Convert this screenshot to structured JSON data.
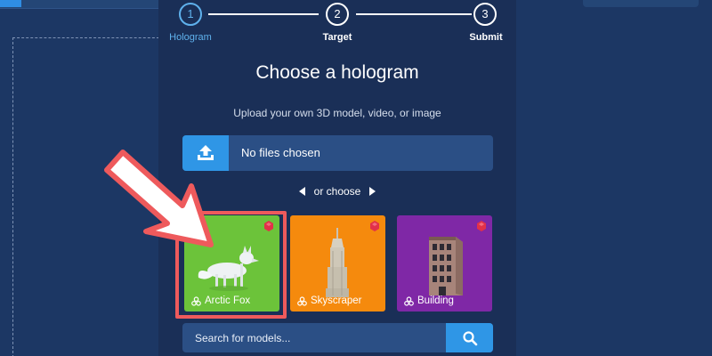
{
  "stepper": {
    "steps": [
      {
        "number": "1",
        "label": "Hologram",
        "active": true
      },
      {
        "number": "2",
        "label": "Target",
        "active": false
      },
      {
        "number": "3",
        "label": "Submit",
        "active": false
      }
    ]
  },
  "main": {
    "title": "Choose a hologram",
    "subtitle": "Upload your own 3D model, video, or image"
  },
  "upload": {
    "status": "No files chosen",
    "icon": "upload-icon"
  },
  "divider": {
    "text": "or choose"
  },
  "models": [
    {
      "name": "Arctic Fox",
      "bg_color": "#6cc33a",
      "selected": true
    },
    {
      "name": "Skyscraper",
      "bg_color": "#f58a0d",
      "selected": false
    },
    {
      "name": "Building",
      "bg_color": "#7f28a6",
      "selected": false
    }
  ],
  "search": {
    "placeholder": "Search for models...",
    "icon": "search-icon"
  },
  "colors": {
    "accent": "#2f96e6",
    "active_step": "#5fb1ec",
    "highlight": "#ee5a5c",
    "gem": "#e23149"
  }
}
